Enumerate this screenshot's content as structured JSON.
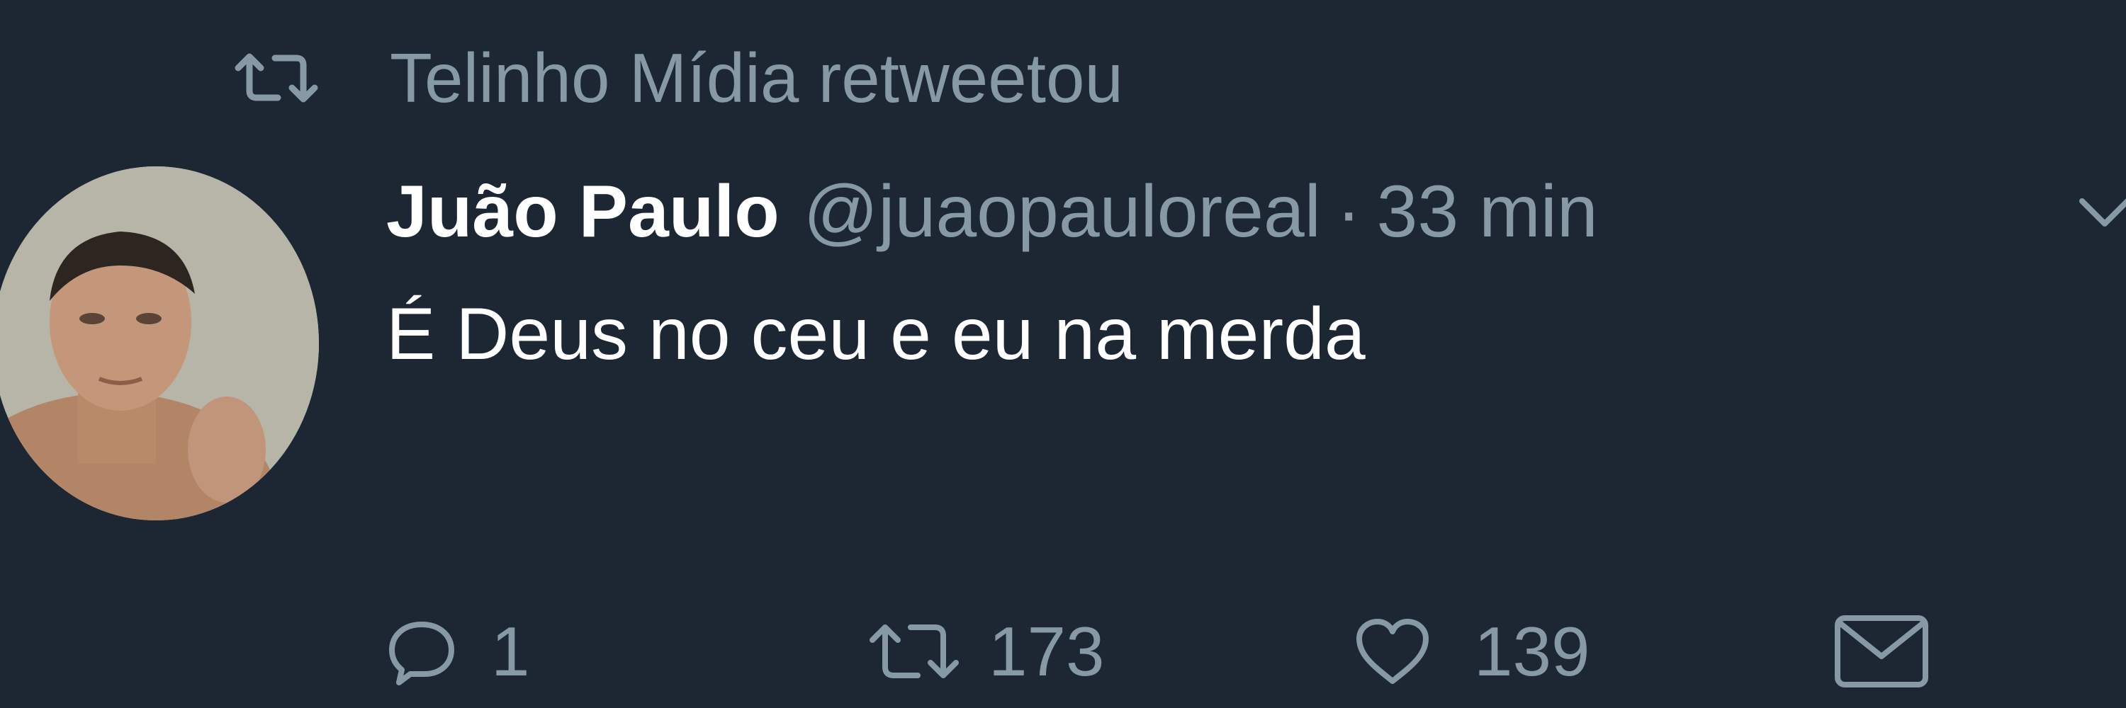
{
  "retweet_header": {
    "icon": "retweet-icon",
    "text": "Telinho Mídia retweetou"
  },
  "author": {
    "display_name": "Juão Paulo",
    "handle": "@juaopauloreal",
    "separator": "·",
    "time": "33 min",
    "avatar": "avatar-photo"
  },
  "tweet": {
    "text": "É Deus no ceu e eu na merda"
  },
  "actions": {
    "reply": {
      "icon": "reply-icon",
      "count": "1"
    },
    "retweet": {
      "icon": "retweet-icon",
      "count": "173"
    },
    "like": {
      "icon": "heart-icon",
      "count": "139"
    },
    "dm": {
      "icon": "envelope-icon"
    }
  },
  "colors": {
    "background": "#1c2733",
    "primary_text": "#ffffff",
    "secondary_text": "#8899a6"
  }
}
